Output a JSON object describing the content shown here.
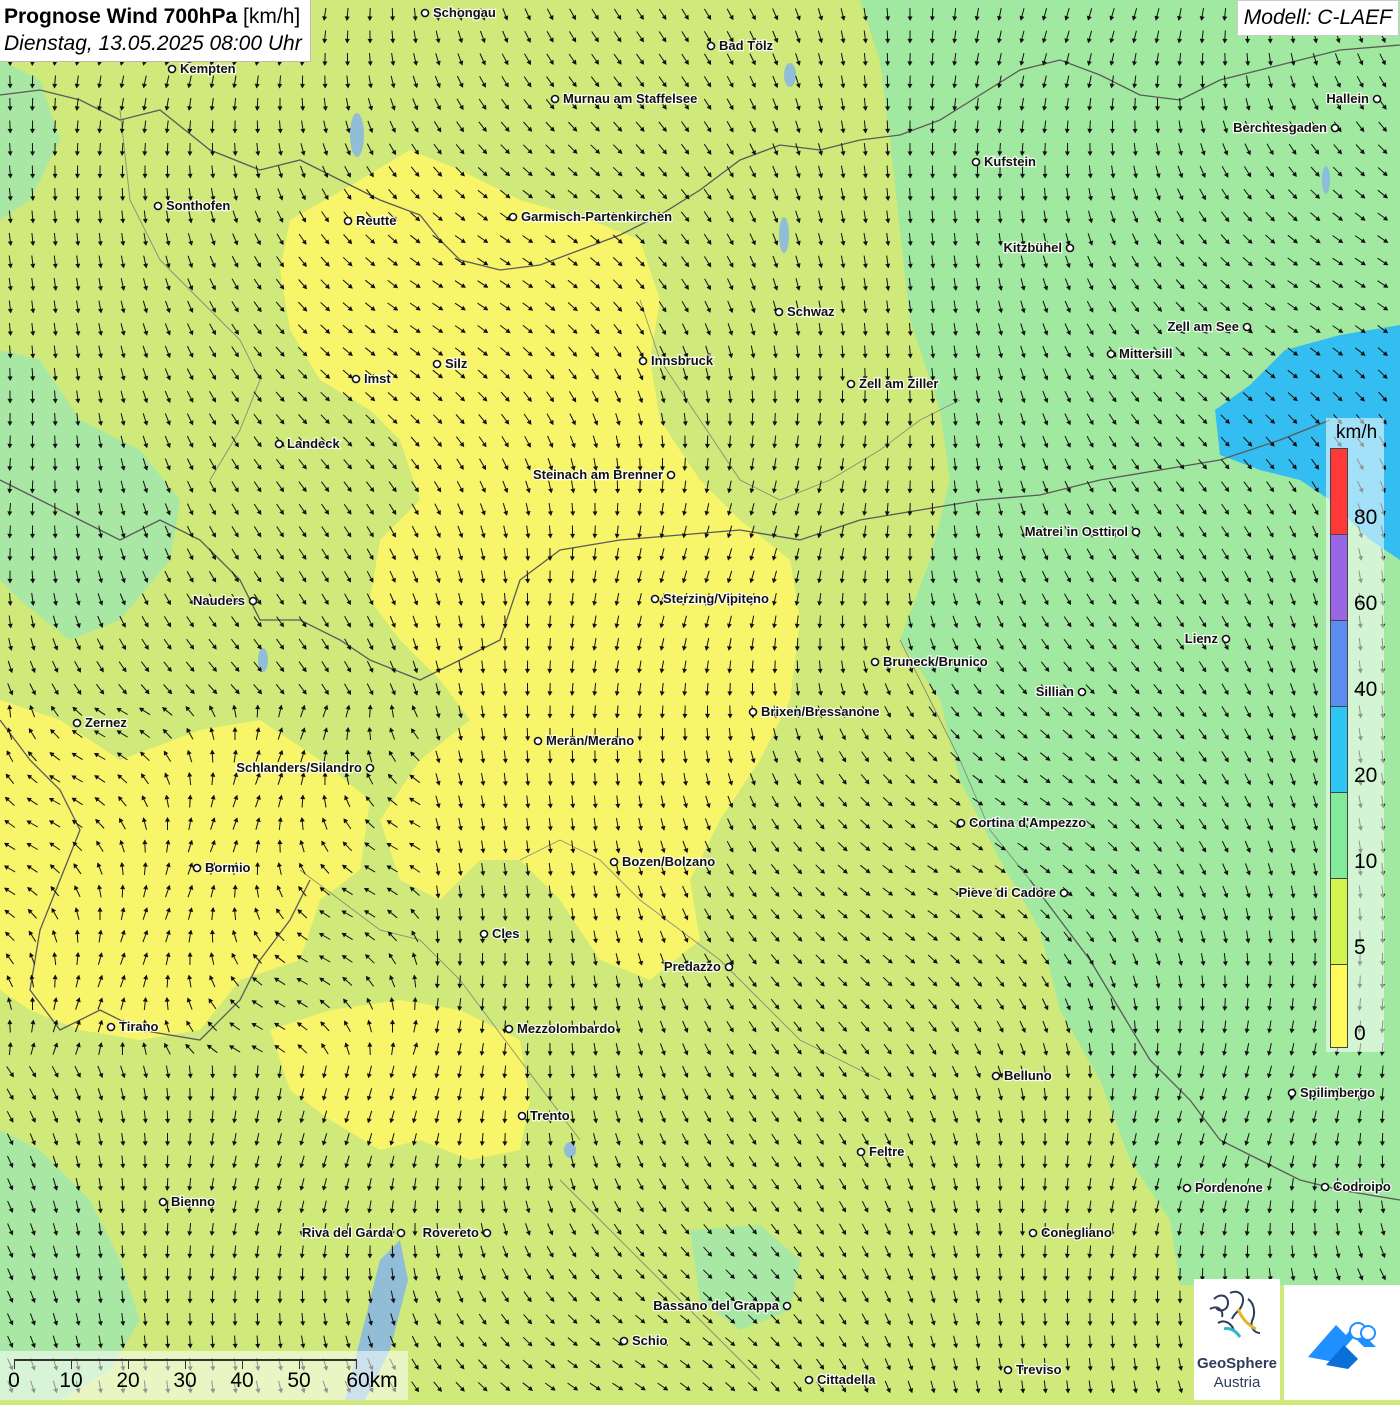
{
  "header": {
    "title_bold": "Prognose Wind 700hPa",
    "title_unit": "[km/h]",
    "datetime": "Dienstag, 13.05.2025 08:00 Uhr",
    "model": "Modell: C-LAEF"
  },
  "legend": {
    "unit": "km/h",
    "ticks": [
      "80",
      "60",
      "40",
      "20",
      "10",
      "5",
      "0"
    ],
    "colors": [
      "#ff3838",
      "#9b66e6",
      "#5b8cf0",
      "#2ec6f2",
      "#82eb9a",
      "#d2f550",
      "#fffa5a"
    ]
  },
  "scale_bar": {
    "labels": [
      "0",
      "10",
      "20",
      "30",
      "40",
      "50",
      "60km"
    ]
  },
  "logos": {
    "geosphere_line1": "GeoSphere",
    "geosphere_line2": "Austria",
    "app_icon": "cloud-mountain-icon"
  },
  "cities": [
    {
      "name": "Schongau"
    },
    {
      "name": "Bad Tölz"
    },
    {
      "name": "Kempten"
    },
    {
      "name": "Murnau am Staffelsee"
    },
    {
      "name": "Hallein"
    },
    {
      "name": "Berchtesgaden"
    },
    {
      "name": "Kufstein"
    },
    {
      "name": "Sonthofen"
    },
    {
      "name": "Reutte"
    },
    {
      "name": "Garmisch-Partenkirchen"
    },
    {
      "name": "Kitzbühel"
    },
    {
      "name": "Schwaz"
    },
    {
      "name": "Zell am See"
    },
    {
      "name": "Mittersill"
    },
    {
      "name": "Silz"
    },
    {
      "name": "Innsbruck"
    },
    {
      "name": "Imst"
    },
    {
      "name": "Zell am Ziller"
    },
    {
      "name": "Landeck"
    },
    {
      "name": "Steinach am Brenner"
    },
    {
      "name": "Matrei in Osttirol"
    },
    {
      "name": "Nauders"
    },
    {
      "name": "Sterzing/Vipiteno"
    },
    {
      "name": "Lienz"
    },
    {
      "name": "Bruneck/Brunico"
    },
    {
      "name": "Sillian"
    },
    {
      "name": "Brixen/Bressanone"
    },
    {
      "name": "Zernez"
    },
    {
      "name": "Meran/Merano"
    },
    {
      "name": "Schlanders/Silandro"
    },
    {
      "name": "Cortina d'Ampezzo"
    },
    {
      "name": "Bozen/Bolzano"
    },
    {
      "name": "Bormio"
    },
    {
      "name": "Pieve di Cadore"
    },
    {
      "name": "Cles"
    },
    {
      "name": "Predazzo"
    },
    {
      "name": "Tirano"
    },
    {
      "name": "Mezzolombardo"
    },
    {
      "name": "Belluno"
    },
    {
      "name": "Spilimbergo"
    },
    {
      "name": "Trento"
    },
    {
      "name": "Feltre"
    },
    {
      "name": "Pordenone"
    },
    {
      "name": "Codroipo"
    },
    {
      "name": "Bienno"
    },
    {
      "name": "Riva del Garda"
    },
    {
      "name": "Rovereto"
    },
    {
      "name": "Conegliano"
    },
    {
      "name": "Bassano del Grappa"
    },
    {
      "name": "Schio"
    },
    {
      "name": "Treviso"
    },
    {
      "name": "Cittadella"
    }
  ]
}
